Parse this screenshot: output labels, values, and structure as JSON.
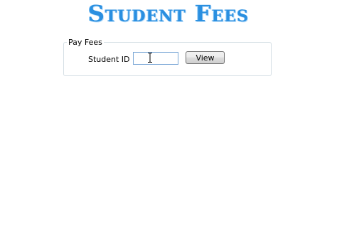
{
  "page": {
    "title": "Student Fees"
  },
  "pay_fees": {
    "group_label": "Pay Fees",
    "student_id_label": "Student ID :",
    "student_id_value": "",
    "view_button_label": "View"
  },
  "colors": {
    "title": "#2a8fe0",
    "groupbox_border": "#d5dfe5",
    "input_border": "#7aa7d6"
  }
}
